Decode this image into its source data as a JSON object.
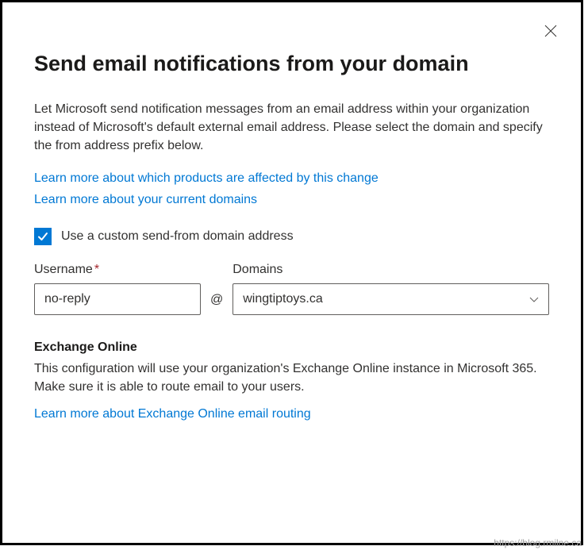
{
  "header": {
    "title": "Send email notifications from your domain"
  },
  "intro": {
    "description": "Let Microsoft send notification messages from an email address within your organization instead of Microsoft's default external email address. Please select the domain and specify the from address prefix below.",
    "link_products": "Learn more about which products are affected by this change",
    "link_domains": "Learn more about your current domains"
  },
  "checkbox": {
    "label": "Use a custom send-from domain address",
    "checked": true
  },
  "form": {
    "username_label": "Username",
    "username_value": "no-reply",
    "at": "@",
    "domains_label": "Domains",
    "domains_value": "wingtiptoys.ca"
  },
  "exchange": {
    "heading": "Exchange Online",
    "text": "This configuration will use your organization's Exchange Online instance in Microsoft 365. Make sure it is able to route email to your users.",
    "link": "Learn more about Exchange Online email routing"
  },
  "watermark": "https://blog.rmilne.ca"
}
